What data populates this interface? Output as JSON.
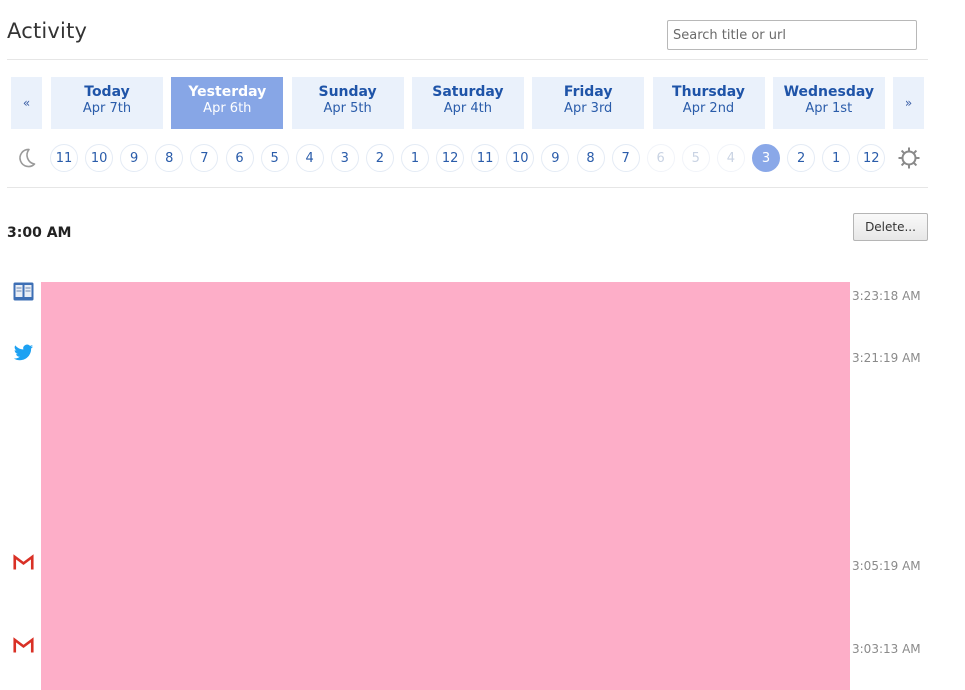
{
  "header": {
    "title": "Activity",
    "search_placeholder": "Search title or url"
  },
  "day_nav": {
    "prev": "«",
    "next": "»"
  },
  "days": [
    {
      "name": "Today",
      "date": "Apr 7th",
      "selected": false
    },
    {
      "name": "Yesterday",
      "date": "Apr 6th",
      "selected": true
    },
    {
      "name": "Sunday",
      "date": "Apr 5th",
      "selected": false
    },
    {
      "name": "Saturday",
      "date": "Apr 4th",
      "selected": false
    },
    {
      "name": "Friday",
      "date": "Apr 3rd",
      "selected": false
    },
    {
      "name": "Thursday",
      "date": "Apr 2nd",
      "selected": false
    },
    {
      "name": "Wednesday",
      "date": "Apr 1st",
      "selected": false
    }
  ],
  "hours": [
    {
      "label": "11",
      "state": "normal"
    },
    {
      "label": "10",
      "state": "normal"
    },
    {
      "label": "9",
      "state": "normal"
    },
    {
      "label": "8",
      "state": "normal"
    },
    {
      "label": "7",
      "state": "normal"
    },
    {
      "label": "6",
      "state": "normal"
    },
    {
      "label": "5",
      "state": "normal"
    },
    {
      "label": "4",
      "state": "normal"
    },
    {
      "label": "3",
      "state": "normal"
    },
    {
      "label": "2",
      "state": "normal"
    },
    {
      "label": "1",
      "state": "normal"
    },
    {
      "label": "12",
      "state": "normal"
    },
    {
      "label": "11",
      "state": "normal"
    },
    {
      "label": "10",
      "state": "normal"
    },
    {
      "label": "9",
      "state": "normal"
    },
    {
      "label": "8",
      "state": "normal"
    },
    {
      "label": "7",
      "state": "normal"
    },
    {
      "label": "6",
      "state": "dim"
    },
    {
      "label": "5",
      "state": "dim"
    },
    {
      "label": "4",
      "state": "dim"
    },
    {
      "label": "3",
      "state": "selected"
    },
    {
      "label": "2",
      "state": "normal"
    },
    {
      "label": "1",
      "state": "normal"
    },
    {
      "label": "12",
      "state": "normal"
    }
  ],
  "section": {
    "time": "3:00 AM",
    "delete_label": "Delete..."
  },
  "entries": [
    {
      "icon": "reading-list-icon",
      "time": "3:23:18 AM"
    },
    {
      "icon": "twitter-icon",
      "time": "3:21:19 AM"
    },
    {
      "icon": "gmail-icon",
      "time": "3:05:19 AM"
    },
    {
      "icon": "gmail-icon",
      "time": "3:03:13 AM"
    }
  ],
  "colors": {
    "accent": "#87a6e6",
    "day_bg": "#eaf1fb",
    "redaction": "#fdaec8",
    "twitter": "#1da1f2",
    "gmail": "#d93025"
  }
}
